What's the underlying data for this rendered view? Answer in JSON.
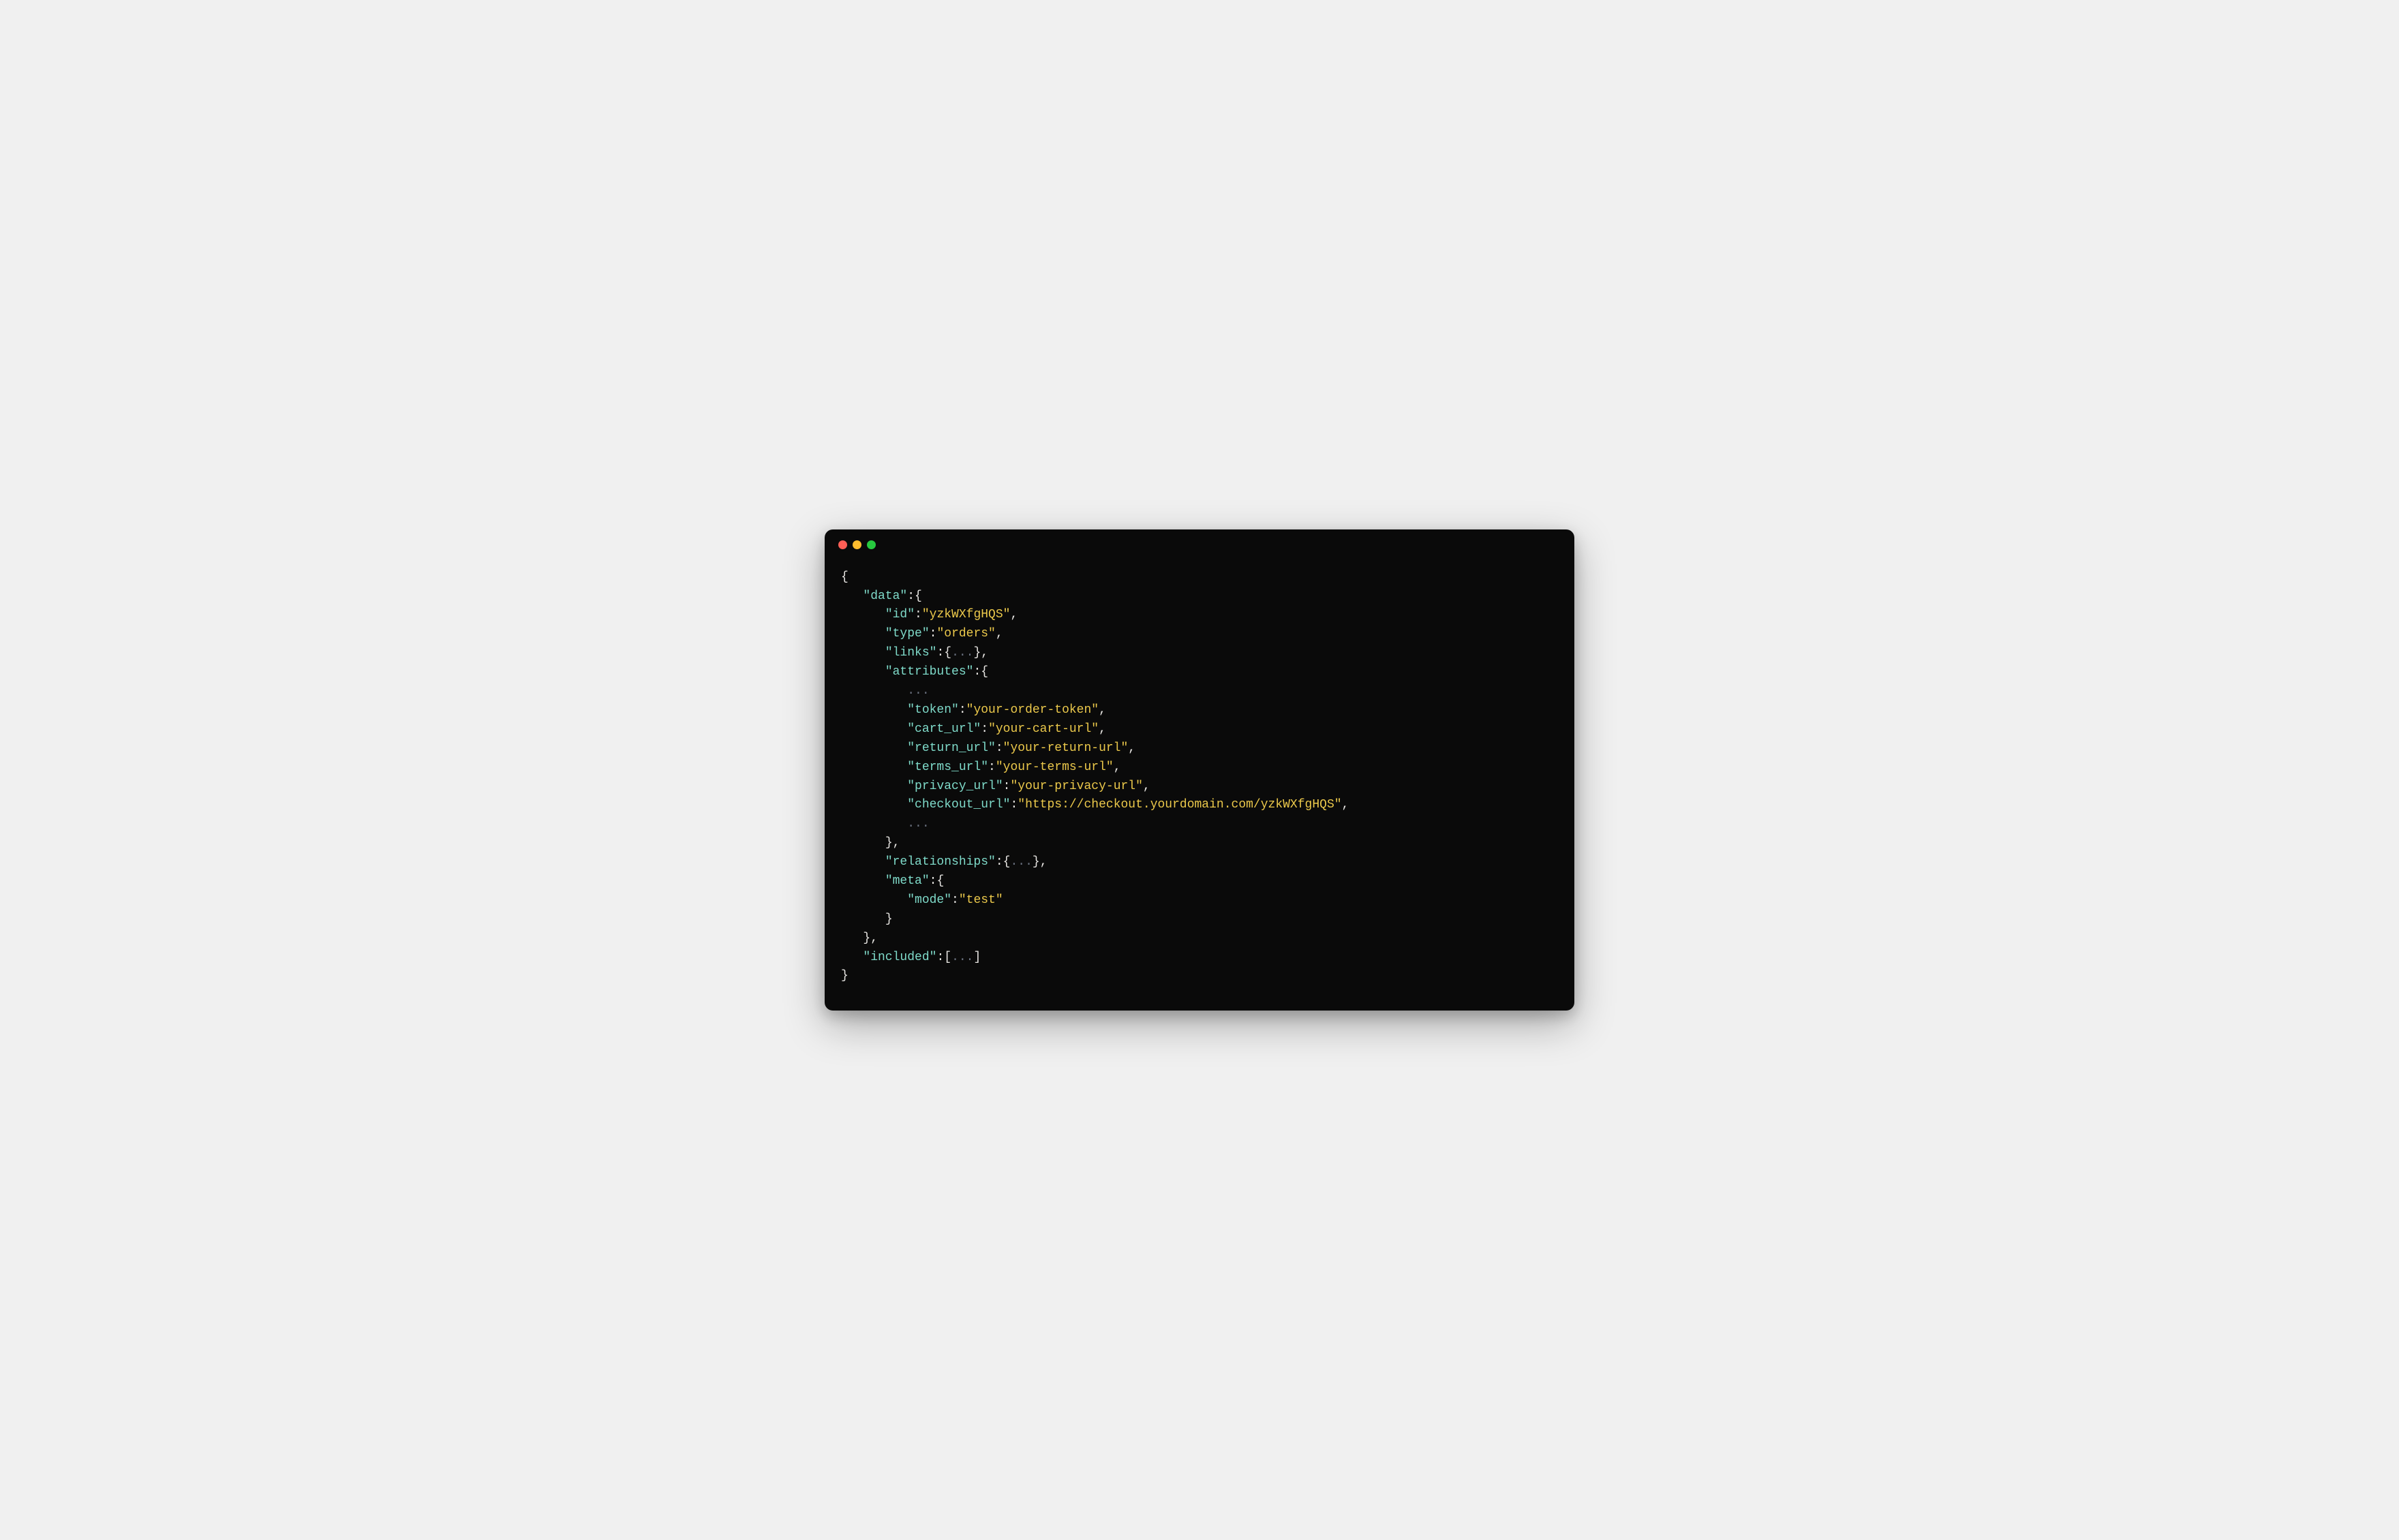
{
  "window": {
    "traffic_lights": [
      "close",
      "minimize",
      "maximize"
    ]
  },
  "code": {
    "keys": {
      "data": "\"data\"",
      "id": "\"id\"",
      "type": "\"type\"",
      "links": "\"links\"",
      "attributes": "\"attributes\"",
      "token": "\"token\"",
      "cart_url": "\"cart_url\"",
      "return_url": "\"return_url\"",
      "terms_url": "\"terms_url\"",
      "privacy_url": "\"privacy_url\"",
      "checkout_url": "\"checkout_url\"",
      "relationships": "\"relationships\"",
      "meta": "\"meta\"",
      "mode": "\"mode\"",
      "included": "\"included\""
    },
    "values": {
      "id": "\"yzkWXfgHQS\"",
      "type": "\"orders\"",
      "token": "\"your-order-token\"",
      "cart_url": "\"your-cart-url\"",
      "return_url": "\"your-return-url\"",
      "terms_url": "\"your-terms-url\"",
      "privacy_url": "\"your-privacy-url\"",
      "checkout_url": "\"https://checkout.yourdomain.com/yzkWXfgHQS\"",
      "mode": "\"test\""
    },
    "punct": {
      "open_brace": "{",
      "close_brace": "}",
      "open_bracket": "[",
      "close_bracket": "]",
      "colon": ":",
      "comma": ","
    },
    "ellipsis": "..."
  }
}
